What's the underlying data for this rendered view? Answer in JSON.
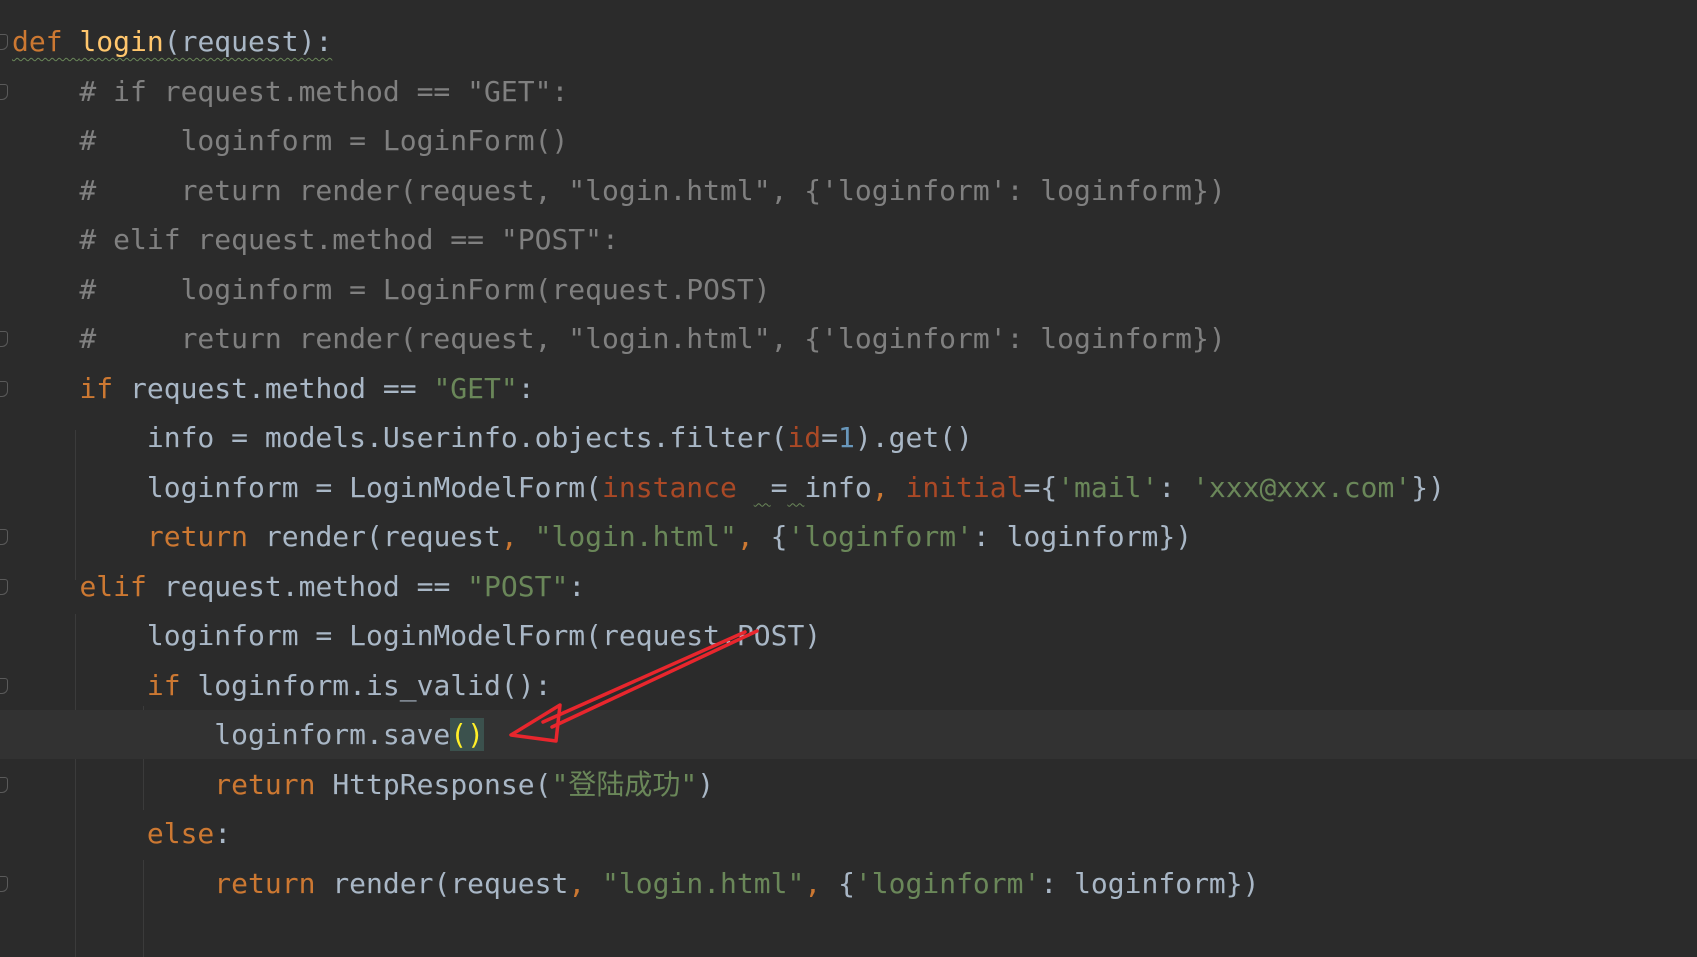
{
  "editor": {
    "theme": "darcula",
    "lines": [
      {
        "tokens": [
          [
            "kw",
            "def "
          ],
          [
            "fn",
            "login"
          ],
          [
            "t",
            "(request):"
          ]
        ],
        "gutter": "fold-start",
        "squiggle": true
      },
      {
        "tokens": [
          [
            "cm",
            "    # if request.method == \"GET\":"
          ]
        ],
        "gutter": "fold-start"
      },
      {
        "tokens": [
          [
            "cm",
            "    #     loginform = LoginForm()"
          ]
        ]
      },
      {
        "tokens": [
          [
            "cm",
            "    #     return render(request, \"login.html\", {'loginform': loginform})"
          ]
        ]
      },
      {
        "tokens": [
          [
            "cm",
            "    # elif request.method == \"POST\":"
          ]
        ]
      },
      {
        "tokens": [
          [
            "cm",
            "    #     loginform = LoginForm(request.POST)"
          ]
        ]
      },
      {
        "tokens": [
          [
            "cm",
            "    #     return render(request, \"login.html\", {'loginform': loginform})"
          ]
        ],
        "gutter": "fold-end"
      },
      {
        "tokens": [
          [
            "t",
            "    "
          ],
          [
            "kw",
            "if "
          ],
          [
            "t",
            "request.method == "
          ],
          [
            "str",
            "\"GET\""
          ],
          [
            "t",
            ":"
          ]
        ],
        "gutter": "fold-start"
      },
      {
        "tokens": [
          [
            "t",
            "        info = models.Userinfo.objects.filter("
          ],
          [
            "param",
            "id"
          ],
          [
            "t",
            "="
          ],
          [
            "num",
            "1"
          ],
          [
            "t",
            ").get()"
          ]
        ]
      },
      {
        "tokens": [
          [
            "t",
            "        loginform = LoginModelForm("
          ],
          [
            "param",
            "instance"
          ],
          [
            "t",
            " "
          ],
          [
            "sq",
            " "
          ],
          [
            "t",
            "="
          ],
          [
            "sq",
            " "
          ],
          [
            "t",
            "info"
          ],
          [
            "kw",
            ", "
          ],
          [
            "param",
            "initial"
          ],
          [
            "t",
            "={"
          ],
          [
            "str",
            "'mail'"
          ],
          [
            "t",
            ": "
          ],
          [
            "str",
            "'xxx@xxx.com'"
          ],
          [
            "t",
            "})"
          ]
        ]
      },
      {
        "tokens": [
          [
            "t",
            "        "
          ],
          [
            "kw",
            "return "
          ],
          [
            "t",
            "render(request"
          ],
          [
            "kw",
            ", "
          ],
          [
            "str",
            "\"login.html\""
          ],
          [
            "kw",
            ", "
          ],
          [
            "t",
            "{"
          ],
          [
            "str",
            "'loginform'"
          ],
          [
            "t",
            ": loginform})"
          ]
        ],
        "gutter": "fold-end"
      },
      {
        "tokens": [
          [
            "t",
            "    "
          ],
          [
            "kw",
            "elif "
          ],
          [
            "t",
            "request.method == "
          ],
          [
            "str",
            "\"POST\""
          ],
          [
            "t",
            ":"
          ]
        ],
        "gutter": "fold-start"
      },
      {
        "tokens": [
          [
            "t",
            "        loginform = LoginModelForm(request.POST)"
          ]
        ]
      },
      {
        "tokens": [
          [
            "t",
            "        "
          ],
          [
            "kw",
            "if "
          ],
          [
            "t",
            "loginform.is_valid():"
          ]
        ],
        "gutter": "fold-start"
      },
      {
        "tokens": [
          [
            "t",
            "            loginform.save"
          ],
          [
            "br",
            "()"
          ]
        ],
        "current": true
      },
      {
        "tokens": [
          [
            "t",
            "            "
          ],
          [
            "kw",
            "return "
          ],
          [
            "t",
            "HttpResponse("
          ],
          [
            "str",
            "\"登陆成功\""
          ],
          [
            "t",
            ")"
          ]
        ],
        "gutter": "fold-end"
      },
      {
        "tokens": [
          [
            "t",
            "        "
          ],
          [
            "kw",
            "else"
          ],
          [
            "t",
            ":"
          ]
        ]
      },
      {
        "tokens": [
          [
            "t",
            "            "
          ],
          [
            "kw",
            "return "
          ],
          [
            "t",
            "render(request"
          ],
          [
            "kw",
            ", "
          ],
          [
            "str",
            "\"login.html\""
          ],
          [
            "kw",
            ", "
          ],
          [
            "t",
            "{"
          ],
          [
            "str",
            "'loginform'"
          ],
          [
            "t",
            ": loginform})"
          ]
        ],
        "gutter": "fold-end"
      },
      {
        "tokens": [
          [
            "t",
            ""
          ]
        ]
      }
    ]
  },
  "annotation": {
    "color": "#e8262d"
  }
}
